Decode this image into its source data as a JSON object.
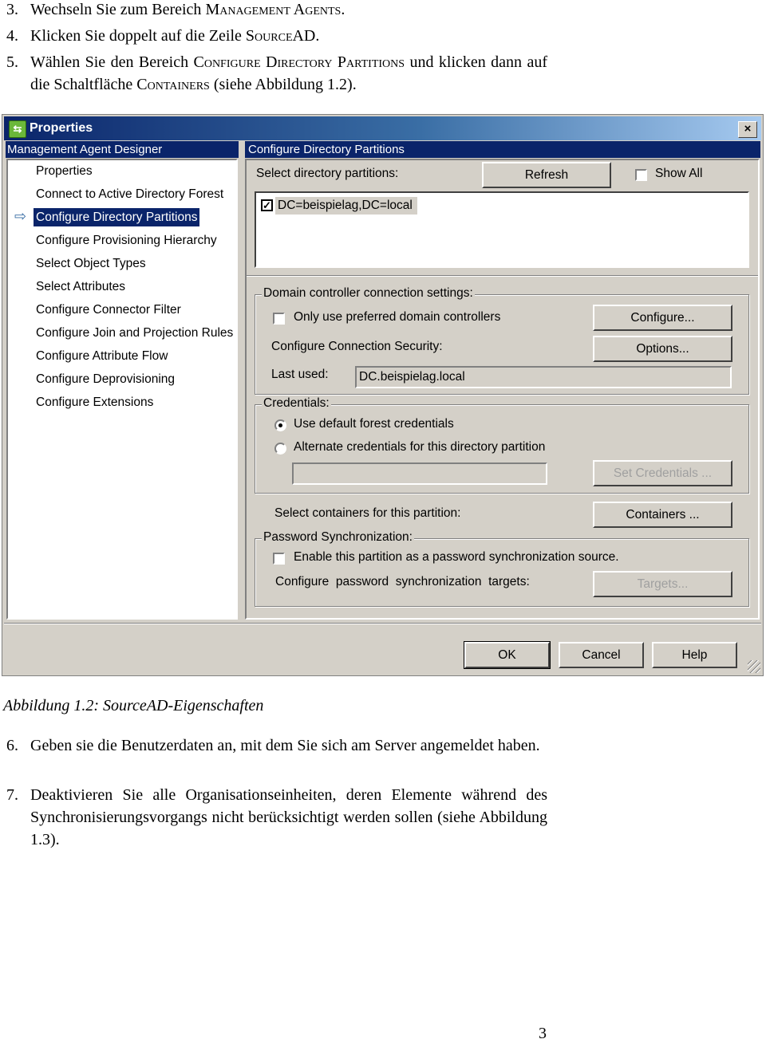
{
  "steps_top": [
    {
      "num": "3.",
      "parts": [
        "Wechseln Sie zum Bereich ",
        {
          "sc": "Management Agents"
        },
        "."
      ]
    },
    {
      "num": "4.",
      "parts": [
        "Klicken Sie doppelt auf die Zeile ",
        {
          "sc": "SourceAD"
        },
        "."
      ]
    },
    {
      "num": "5.",
      "parts": [
        "Wählen Sie den Bereich ",
        {
          "sc": "Configure Directory Partitions"
        },
        " und klicken dann auf die Schaltfläche ",
        {
          "sc": "Containers"
        },
        " (siehe Abbildung 1.2)."
      ]
    }
  ],
  "dialog": {
    "title": "Properties",
    "close_label": "×",
    "left_header": "Management Agent Designer",
    "right_header": "Configure Directory Partitions",
    "nav_items": [
      "Properties",
      "Connect to Active Directory Forest",
      "Configure Directory Partitions",
      "Configure Provisioning Hierarchy",
      "Select Object Types",
      "Select Attributes",
      "Configure Connector Filter",
      "Configure Join and Projection Rules",
      "Configure Attribute Flow",
      "Configure Deprovisioning",
      "Configure Extensions"
    ],
    "selected_nav_index": 2,
    "select_partitions_label": "Select directory partitions:",
    "refresh_label": "Refresh",
    "show_all_label": "Show All",
    "show_all_checked": false,
    "partitions": [
      {
        "name": "DC=beispielag,DC=local",
        "checked": true
      }
    ],
    "dc_group": {
      "legend": "Domain controller connection settings:",
      "preferred_label": "Only use preferred domain controllers",
      "preferred_checked": false,
      "configure_label": "Configure...",
      "security_label": "Configure Connection Security:",
      "options_label": "Options...",
      "last_used_label": "Last used:",
      "last_used_value": "DC.beispielag.local"
    },
    "cred_group": {
      "legend": "Credentials:",
      "default_label": "Use default forest credentials",
      "alternate_label": "Alternate credentials for this directory partition",
      "selected": "default",
      "credential_value": "",
      "set_credentials_label": "Set Credentials ..."
    },
    "containers_label": "Select containers for this partition:",
    "containers_button": "Containers ...",
    "pwd_group": {
      "legend": "Password Synchronization:",
      "enable_label": "Enable this partition as a password synchronization source.",
      "enable_checked": false,
      "targets_label": "Configure  password  synchronization  targets:",
      "targets_button": "Targets..."
    },
    "ok_label": "OK",
    "cancel_label": "Cancel",
    "help_label": "Help"
  },
  "caption": "Abbildung 1.2: SourceAD-Eigenschaften",
  "steps_bottom": [
    {
      "num": "6.",
      "parts": [
        "Geben sie die Benutzerdaten an, mit dem Sie sich am Server angemeldet haben."
      ]
    },
    {
      "num": "7.",
      "parts": [
        "Deaktivieren Sie alle Organisationseinheiten, deren Elemente während des Synchronisierungsvorgangs nicht berücksichtigt werden sollen (siehe Abbildung 1.3)."
      ]
    }
  ],
  "page_number": "3"
}
